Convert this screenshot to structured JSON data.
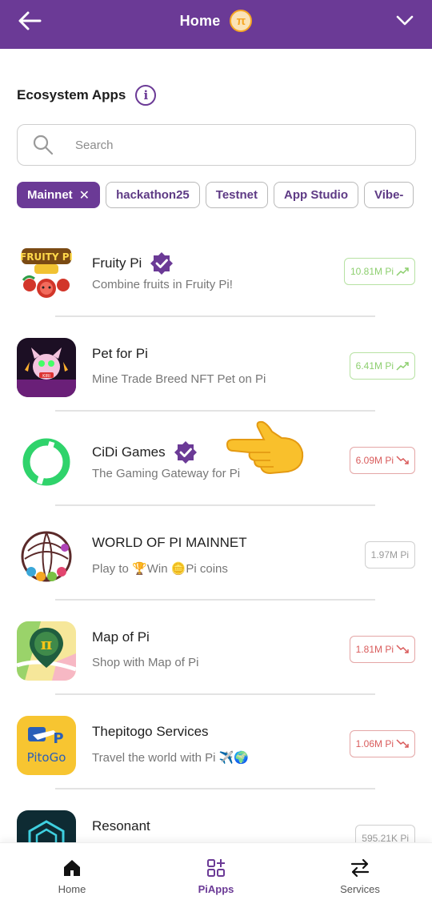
{
  "header": {
    "title": "Home",
    "pi_symbol": "π"
  },
  "section": {
    "title": "Ecosystem Apps",
    "info_icon": "i"
  },
  "search": {
    "placeholder": "Search"
  },
  "chips": [
    {
      "label": "Mainnet",
      "active": true
    },
    {
      "label": "hackathon25",
      "active": false
    },
    {
      "label": "Testnet",
      "active": false
    },
    {
      "label": "App Studio",
      "active": false
    },
    {
      "label": "Vibe-",
      "active": false
    }
  ],
  "apps": [
    {
      "name": "Fruity Pi",
      "description": "Combine fruits in Fruity Pi!",
      "volume": "10.81M Pi",
      "trend": "up",
      "verified": true,
      "icon_label": "FRUITY PI"
    },
    {
      "name": "Pet for Pi",
      "description": "Mine Trade Breed NFT Pet on Pi",
      "volume": "6.41M Pi",
      "trend": "up",
      "verified": false,
      "icon_label": "KIRI"
    },
    {
      "name": "CiDi Games",
      "description": "The Gaming Gateway for Pi",
      "volume": "6.09M Pi",
      "trend": "down",
      "verified": true,
      "icon_label": ""
    },
    {
      "name": "WORLD OF PI MAINNET",
      "description": "Play to 🏆Win 🪙Pi coins",
      "volume": "1.97M Pi",
      "trend": "flat",
      "verified": false,
      "icon_label": ""
    },
    {
      "name": "Map of Pi",
      "description": "Shop with Map of Pi",
      "volume": "1.81M Pi",
      "trend": "down",
      "verified": false,
      "icon_label": "π"
    },
    {
      "name": "Thepitogo Services",
      "description": "Travel the world with Pi ✈️🌍",
      "volume": "1.06M Pi",
      "trend": "down",
      "verified": false,
      "icon_label": "PitoGo"
    },
    {
      "name": "Resonant",
      "description": "",
      "volume": "595.21K Pi",
      "trend": "flat",
      "verified": false,
      "icon_label": ""
    }
  ],
  "nav": [
    {
      "label": "Home",
      "icon": "home-icon",
      "active": false
    },
    {
      "label": "PiApps",
      "icon": "apps-grid-icon",
      "active": true
    },
    {
      "label": "Services",
      "icon": "swap-arrows-icon",
      "active": false
    }
  ],
  "colors": {
    "brand": "#6b3a96",
    "accent_gold": "#f6a623",
    "trend_up": "#8dcf6f",
    "trend_down": "#d95b5b"
  }
}
